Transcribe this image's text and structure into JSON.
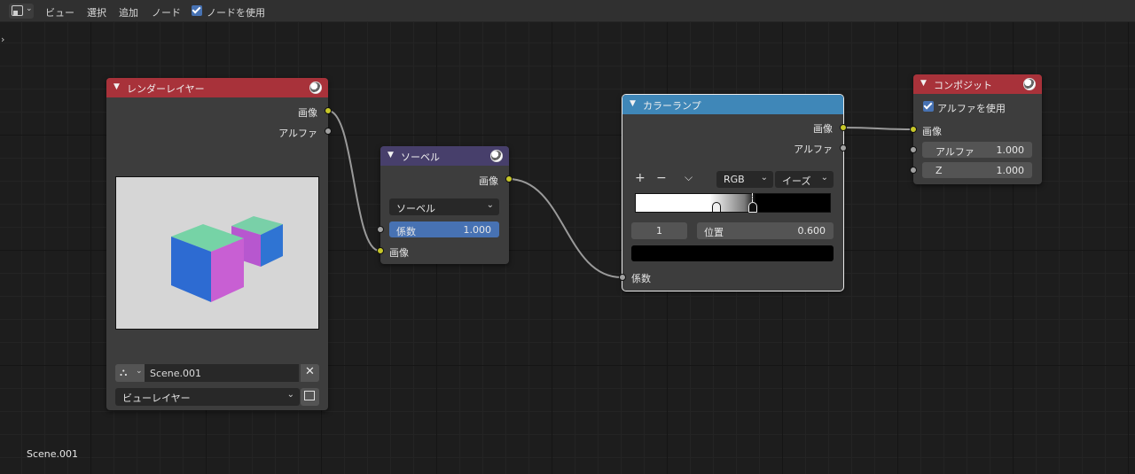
{
  "menu": {
    "view": "ビュー",
    "select": "選択",
    "add": "追加",
    "node": "ノード",
    "use_nodes": "ノードを使用"
  },
  "bottom_label": "Scene.001",
  "render_layers": {
    "title": "レンダーレイヤー",
    "out_image": "画像",
    "out_alpha": "アルファ",
    "scene": "Scene.001",
    "view_layer": "ビューレイヤー"
  },
  "sobel": {
    "title": "ソーベル",
    "out_image": "画像",
    "filter_type": "ソーベル",
    "factor_label": "係数",
    "factor_value": "1.000",
    "in_image": "画像"
  },
  "color_ramp": {
    "title": "カラーランプ",
    "out_image": "画像",
    "out_alpha": "アルファ",
    "add": "+",
    "remove": "−",
    "more": "⌵",
    "mode": "RGB",
    "interpolation": "イーズ",
    "active_index": "1",
    "position_label": "位置",
    "position_value": "0.600",
    "in_factor": "係数"
  },
  "composite": {
    "title": "コンポジット",
    "use_alpha": "アルファを使用",
    "in_image": "画像",
    "alpha_label": "アルファ",
    "alpha_value": "1.000",
    "z_label": "Z",
    "z_value": "1.000"
  },
  "colors": {
    "render_header": "#a8323a",
    "sobel_header": "#473f6b",
    "ramp_header": "#3f87b8",
    "composite_header": "#a8323a",
    "accent": "#4772b3",
    "socket_color": "#c7c729",
    "socket_gray": "#a1a1a1"
  }
}
